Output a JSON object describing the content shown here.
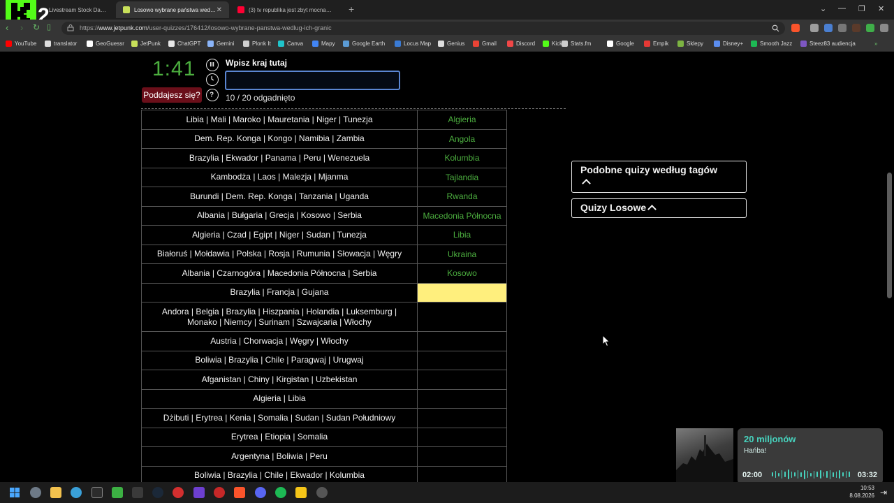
{
  "browser": {
    "tabs": [
      {
        "label": "Livestream Stock Dashboard",
        "active": false,
        "favicon": "dashboard-icon"
      },
      {
        "label": "Losowo wybrane państwa według ich granic",
        "active": true,
        "favicon": "jetpunk-icon"
      },
      {
        "label": "(3) tv republika jest zbyt mocna - YouTube",
        "active": false,
        "favicon": "youtube-icon"
      }
    ],
    "new_tab_label": "+",
    "url_host": "www.jetpunk.com",
    "url_prefix": "https://",
    "url_path": "/user-quizzes/176412/losowo-wybrane-panstwa-wedlug-ich-granic",
    "bookmarks": [
      {
        "label": "YouTube",
        "color": "#ff0000"
      },
      {
        "label": "translator",
        "color": "#dddddd"
      },
      {
        "label": "GeoGuessr",
        "color": "#ffffff"
      },
      {
        "label": "JetPunk",
        "color": "#c8e05a"
      },
      {
        "label": "ChatGPT",
        "color": "#e6e6e6"
      },
      {
        "label": "Gemini",
        "color": "#8ab4f8"
      },
      {
        "label": "Plonk It",
        "color": "#cfcfcf"
      },
      {
        "label": "Canva",
        "color": "#20c4cb"
      },
      {
        "label": "Mapy",
        "color": "#4285f4"
      },
      {
        "label": "Google Earth",
        "color": "#5b9bd5"
      },
      {
        "label": "Locus Map",
        "color": "#3a7bd5"
      },
      {
        "label": "Genius",
        "color": "#dddddd"
      },
      {
        "label": "Gmail",
        "color": "#ea4335"
      },
      {
        "label": "Discord",
        "color": "#f04747"
      },
      {
        "label": "Kick",
        "color": "#53fc18"
      },
      {
        "label": "Stats.fm",
        "color": "#cccccc"
      },
      {
        "label": "Google",
        "color": "#ffffff"
      },
      {
        "label": "Empik",
        "color": "#e53935"
      },
      {
        "label": "Sklepy",
        "color": "#7cb342"
      },
      {
        "label": "Disney+",
        "color": "#5b8def"
      },
      {
        "label": "Smooth Jazz",
        "color": "#1db954"
      },
      {
        "label": "Steez83 audiencja",
        "color": "#7e57c2"
      }
    ]
  },
  "quiz": {
    "timer": "1:41",
    "give_up_label": "Poddajesz się?",
    "prompt_label": "Wpisz kraj tutaj",
    "input_value": "",
    "progress_text": "10 / 20 odgadnięto",
    "rows": [
      {
        "clue": "Libia | Mali | Maroko | Mauretania | Niger | Tunezja",
        "answer": "Algieria"
      },
      {
        "clue": "Dem. Rep. Konga | Kongo | Namibia | Zambia",
        "answer": "Angola"
      },
      {
        "clue": "Brazylia | Ekwador | Panama | Peru | Wenezuela",
        "answer": "Kolumbia"
      },
      {
        "clue": "Kambodża | Laos | Malezja | Mjanma",
        "answer": "Tajlandia"
      },
      {
        "clue": "Burundi | Dem. Rep. Konga | Tanzania | Uganda",
        "answer": "Rwanda"
      },
      {
        "clue": "Albania | Bułgaria | Grecja | Kosowo | Serbia",
        "answer": "Macedonia Północna"
      },
      {
        "clue": "Algieria | Czad | Egipt | Niger | Sudan | Tunezja",
        "answer": "Libia"
      },
      {
        "clue": "Białoruś | Mołdawia | Polska | Rosja | Rumunia | Słowacja | Węgry",
        "answer": "Ukraina"
      },
      {
        "clue": "Albania | Czarnogóra | Macedonia Północna | Serbia",
        "answer": "Kosowo"
      },
      {
        "clue": "Brazylia | Francja | Gujana",
        "answer": ""
      },
      {
        "clue": "Andora | Belgia | Brazylia | Hiszpania | Holandia | Luksemburg | Monako | Niemcy | Surinam | Szwajcaria | Włochy",
        "answer": ""
      },
      {
        "clue": "Austria | Chorwacja | Węgry | Włochy",
        "answer": ""
      },
      {
        "clue": "Boliwia | Brazylia | Chile | Paragwaj | Urugwaj",
        "answer": ""
      },
      {
        "clue": "Afganistan | Chiny | Kirgistan | Uzbekistan",
        "answer": ""
      },
      {
        "clue": "Algieria | Libia",
        "answer": ""
      },
      {
        "clue": "Dżibuti | Erytrea | Kenia | Somalia | Sudan | Sudan Południowy",
        "answer": ""
      },
      {
        "clue": "Erytrea | Etiopia | Somalia",
        "answer": ""
      },
      {
        "clue": "Argentyna | Boliwia | Peru",
        "answer": ""
      },
      {
        "clue": "Boliwia | Brazylia | Chile | Ekwador | Kolumbia",
        "answer": ""
      }
    ],
    "current_row": 9
  },
  "sidebar": {
    "similar_quizzes_label": "Podobne quizy według tagów",
    "random_quizzes_label": "Quizy Losowe"
  },
  "player": {
    "song": "20 miljonów",
    "artist": "Hańba!",
    "elapsed": "02:00",
    "duration": "03:32",
    "progress_fraction": 0.566
  },
  "taskbar": {
    "time": "10:53",
    "date": "8.08.2026"
  },
  "colors": {
    "accent_green": "#4caf3f",
    "current_answer": "#ffef7d",
    "player_accent": "#47d3be"
  }
}
